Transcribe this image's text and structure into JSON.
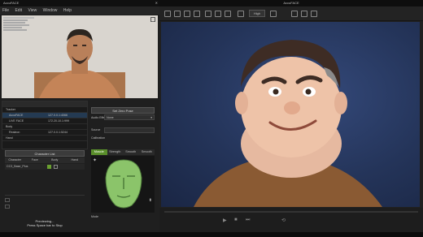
{
  "left_app": {
    "title": "AccuFACE",
    "menu": [
      "File",
      "Edit",
      "View",
      "Window",
      "Help"
    ],
    "tree_rows": [
      {
        "label": "Tracker",
        "value": ""
      },
      {
        "label": "AccuFACE",
        "value": "127.0.0.1:4066"
      },
      {
        "label": "LIVE FACE",
        "value": "172.20.10.1:999"
      },
      {
        "label": "Body",
        "value": ""
      },
      {
        "label": "Realeon",
        "value": "127.0.0.1:5244"
      },
      {
        "label": "Hand",
        "value": ""
      }
    ],
    "character_list_label": "Character List",
    "columns": [
      "Character",
      "Face",
      "Body",
      "Hand"
    ],
    "character_row": "CC3_Base_Plus",
    "set_zero_pose": "Set Zero Pose",
    "audio_effect_label": "Audio Effect",
    "audio_effect_value": "None",
    "source_label": "Source",
    "calibration_label": "Calibration",
    "expression_tabs": [
      "Muscle",
      "Strength",
      "Smooth",
      "Smooth"
    ],
    "mode_label": "Mode",
    "status_line1": "Previewing...",
    "status_line2": "Press Space bar to Stop"
  },
  "right_app": {
    "title": "AccuFACE",
    "quality": "High"
  },
  "colors": {
    "accent_green": "#5a8f2b",
    "viewport_bg": "#2a3b66"
  }
}
